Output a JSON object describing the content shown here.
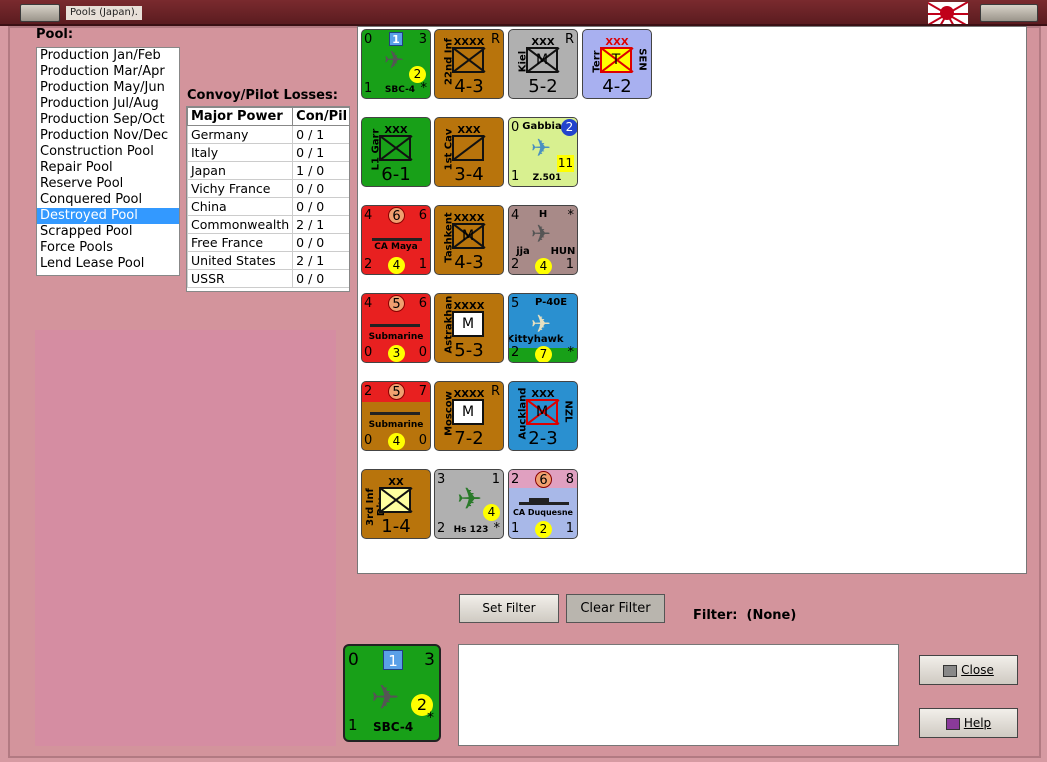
{
  "window": {
    "title": "Pools (Japan)."
  },
  "pool": {
    "label": "Pool:",
    "items": [
      "Production Jan/Feb",
      "Production Mar/Apr",
      "Production May/Jun",
      "Production Jul/Aug",
      "Production Sep/Oct",
      "Production Nov/Dec",
      "Construction Pool",
      "Repair Pool",
      "Reserve Pool",
      "Conquered Pool",
      "Destroyed Pool",
      "Scrapped Pool",
      "Force Pools",
      "Lend Lease Pool"
    ],
    "selected": "Destroyed Pool"
  },
  "losses": {
    "label": "Convoy/Pilot Losses:",
    "headers": [
      "Major Power",
      "Con/Pil"
    ],
    "rows": [
      [
        "Germany",
        "0 / 1"
      ],
      [
        "Italy",
        "0 / 1"
      ],
      [
        "Japan",
        "1 / 0"
      ],
      [
        "Vichy France",
        "0 / 0"
      ],
      [
        "China",
        "0 / 0"
      ],
      [
        "Commonwealth",
        "2 / 1"
      ],
      [
        "Free France",
        "0 / 0"
      ],
      [
        "United States",
        "2 / 1"
      ],
      [
        "USSR",
        "0 / 0"
      ]
    ]
  },
  "counters": {
    "c1": {
      "tl": "0",
      "tr": "3",
      "bl": "1",
      "br": "*",
      "sq": "1",
      "circ": "2",
      "name": "SBC-4",
      "color": "#18a018"
    },
    "c2": {
      "side": "22nd Inf",
      "hdr": "XXXX",
      "r": "R",
      "big": "4-3",
      "color": "#b8740c"
    },
    "c3": {
      "side": "Kiel",
      "hdr": "XXX",
      "r": "R",
      "m": "M",
      "big": "5-2",
      "color": "#b0b0b0"
    },
    "c4": {
      "side": "Terr",
      "hdr": "XXX",
      "t": "T",
      "rside": "SEN",
      "big": "4-2",
      "color": "#a8b0f0"
    },
    "c5": {
      "side": "L1 Garr",
      "hdr": "XXX",
      "big": "6-1",
      "color": "#18a018"
    },
    "c6": {
      "side": "1st Cav",
      "hdr": "XXX",
      "big": "3-4",
      "color": "#b8740c"
    },
    "c7": {
      "name": "Gabbiano",
      "tl": "0",
      "circ": "2",
      "yc": "11",
      "bl": "1",
      "model": "Z.501",
      "color": "#d8f090"
    },
    "c8": {
      "tl": "4",
      "circ": "6",
      "tr": "6",
      "name": "CA Maya",
      "bl": "2",
      "yc": "4",
      "br": "1",
      "color": "#e82020"
    },
    "c9": {
      "side": "Tashkent",
      "hdr": "XXXX",
      "m": "M",
      "big": "4-3",
      "color": "#b8740c"
    },
    "c10": {
      "tl": "4",
      "h": "H",
      "star": "*",
      "name": "jja",
      "nat": "HUN",
      "bl": "2",
      "yc": "4",
      "br": "1",
      "color": "#a88a88"
    },
    "c11": {
      "tl": "4",
      "circ": "5",
      "tr": "6",
      "name": "Submarine",
      "bl": "0",
      "yc": "3",
      "br": "0",
      "color": "#e82020"
    },
    "c12": {
      "side": "Astrakhan",
      "hdr": "XXXX",
      "m": "M",
      "big": "5-3",
      "color": "#b8740c"
    },
    "c13": {
      "tl": "5",
      "model": "P-40E",
      "name": "Kittyhawk",
      "bl": "2",
      "yc": "7",
      "br": "*",
      "color": "#2a90d0"
    },
    "c14": {
      "tl": "2",
      "circ": "5",
      "tr": "7",
      "name": "Submarine",
      "bl": "0",
      "yc": "4",
      "br": "0",
      "color": "#b8740c"
    },
    "c15": {
      "side": "Moscow",
      "hdr": "XXXX",
      "r": "R",
      "m": "M",
      "big": "7-2",
      "color": "#b8740c"
    },
    "c16": {
      "side": "Auckland",
      "hdr": "XXX",
      "m": "M",
      "rside": "NZL",
      "big": "2-3",
      "color": "#2a90d0"
    },
    "c17": {
      "side": "3rd Inf Div",
      "hdr": "XX",
      "big": "1-4",
      "color": "#b8740c"
    },
    "c18": {
      "tl": "3",
      "tr": "1",
      "yc": "4",
      "bl": "2",
      "name": "Hs 123",
      "br": "*",
      "color": "#b0b0b0"
    },
    "c19": {
      "tl": "2",
      "circ": "6",
      "tr": "8",
      "name": "CA Duquesne",
      "bl": "1",
      "yc": "2",
      "br": "1",
      "color": "#a8b8e8"
    }
  },
  "filter": {
    "set_label": "Set Filter",
    "clear_label": "Clear Filter",
    "label": "Filter:",
    "value": "(None)"
  },
  "selected_counter": {
    "tl": "0",
    "sq": "1",
    "tr": "3",
    "circ": "2",
    "bl": "1",
    "name": "SBC-4",
    "br": "*"
  },
  "buttons": {
    "close": "Close",
    "help": "Help"
  }
}
